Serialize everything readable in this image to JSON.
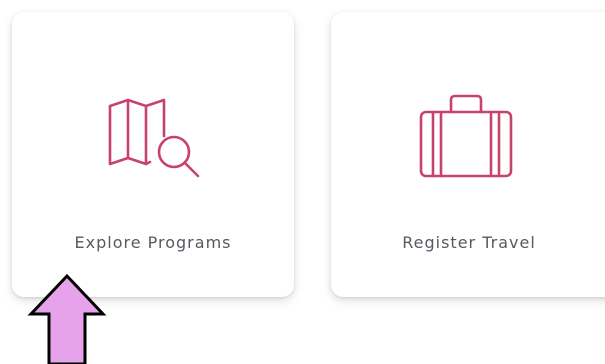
{
  "tiles": [
    {
      "label": "Explore Programs",
      "icon": "map-search-icon"
    },
    {
      "label": "Register Travel",
      "icon": "suitcase-icon"
    }
  ],
  "colors": {
    "accent": "#c8436b",
    "label_text": "#555a60",
    "arrow_fill": "#e6a3ec",
    "arrow_stroke": "#000000"
  },
  "annotation": {
    "icon": "up-arrow-icon"
  }
}
